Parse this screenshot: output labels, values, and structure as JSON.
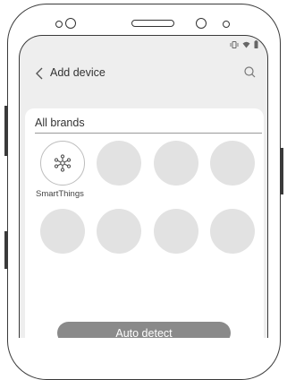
{
  "header": {
    "title": "Add device",
    "back_icon": "chevron-left-icon",
    "search_icon": "search-icon"
  },
  "status_bar": {
    "icons": [
      "vibrate-icon",
      "wifi-icon",
      "battery-icon"
    ]
  },
  "filter": {
    "label": "All brands"
  },
  "brands": [
    {
      "label": "SmartThings",
      "icon": "smartthings-logo-icon"
    },
    {
      "label": ""
    },
    {
      "label": ""
    },
    {
      "label": ""
    },
    {
      "label": ""
    },
    {
      "label": ""
    },
    {
      "label": ""
    },
    {
      "label": ""
    }
  ],
  "actions": {
    "auto_detect_label": "Auto detect"
  },
  "colors": {
    "screen_bg": "#eeeeee",
    "card_bg": "#ffffff",
    "tile_placeholder": "#e2e2e2",
    "button_bg": "#8a8a8a",
    "button_text": "#ffffff"
  }
}
